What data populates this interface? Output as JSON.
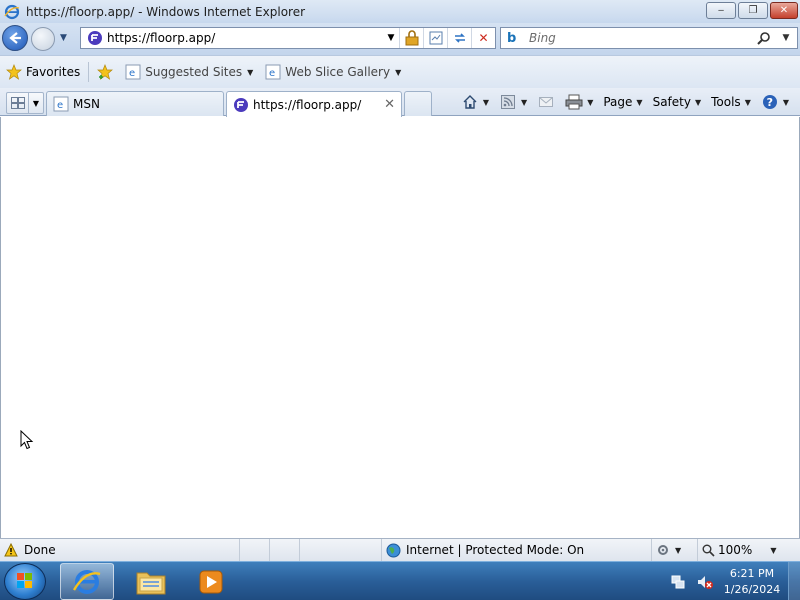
{
  "window": {
    "title": "https://floorp.app/ - Windows Internet Explorer",
    "minimize_glyph": "‒",
    "maximize_glyph": "❐",
    "close_glyph": "✕"
  },
  "address_bar": {
    "url": "https://floorp.app/",
    "search_placeholder": "Bing"
  },
  "favorites_bar": {
    "favorites_label": "Favorites",
    "suggested_sites_label": "Suggested Sites",
    "web_slice_gallery_label": "Web Slice Gallery"
  },
  "tabs": [
    {
      "label": "MSN",
      "active": false
    },
    {
      "label": "https://floorp.app/",
      "active": true
    }
  ],
  "command_bar": {
    "page_label": "Page",
    "safety_label": "Safety",
    "tools_label": "Tools"
  },
  "status_bar": {
    "status_text": "Done",
    "zone_text": "Internet | Protected Mode: On",
    "zoom_text": "100%"
  },
  "taskbar": {
    "time": "6:21 PM",
    "date": "1/26/2024"
  },
  "colors": {
    "ie_blue": "#1c55b5",
    "floorp_purple": "#4b3bbd",
    "taskbar_blue": "#2a5f99"
  }
}
